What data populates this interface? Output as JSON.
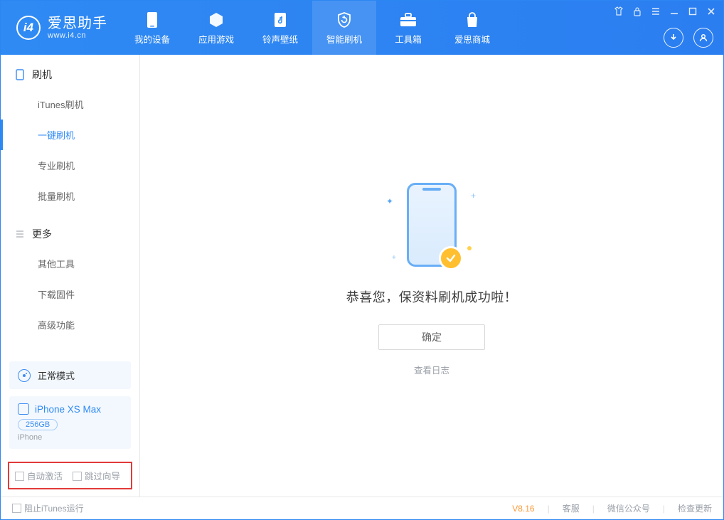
{
  "logo": {
    "ch": "爱思助手",
    "en": "www.i4.cn",
    "mark": "i4"
  },
  "tabs": [
    {
      "label": "我的设备"
    },
    {
      "label": "应用游戏"
    },
    {
      "label": "铃声壁纸"
    },
    {
      "label": "智能刷机"
    },
    {
      "label": "工具箱"
    },
    {
      "label": "爱思商城"
    }
  ],
  "sidebar": {
    "section1": {
      "title": "刷机",
      "items": [
        "iTunes刷机",
        "一键刷机",
        "专业刷机",
        "批量刷机"
      ]
    },
    "section2": {
      "title": "更多",
      "items": [
        "其他工具",
        "下载固件",
        "高级功能"
      ]
    }
  },
  "mode": {
    "label": "正常模式"
  },
  "device": {
    "name": "iPhone XS Max",
    "capacity": "256GB",
    "type": "iPhone"
  },
  "options": {
    "opt1": "自动激活",
    "opt2": "跳过向导"
  },
  "main": {
    "message": "恭喜您，保资料刷机成功啦！",
    "ok": "确定",
    "log": "查看日志"
  },
  "footer": {
    "block_itunes": "阻止iTunes运行",
    "version": "V8.16",
    "links": [
      "客服",
      "微信公众号",
      "检查更新"
    ]
  }
}
